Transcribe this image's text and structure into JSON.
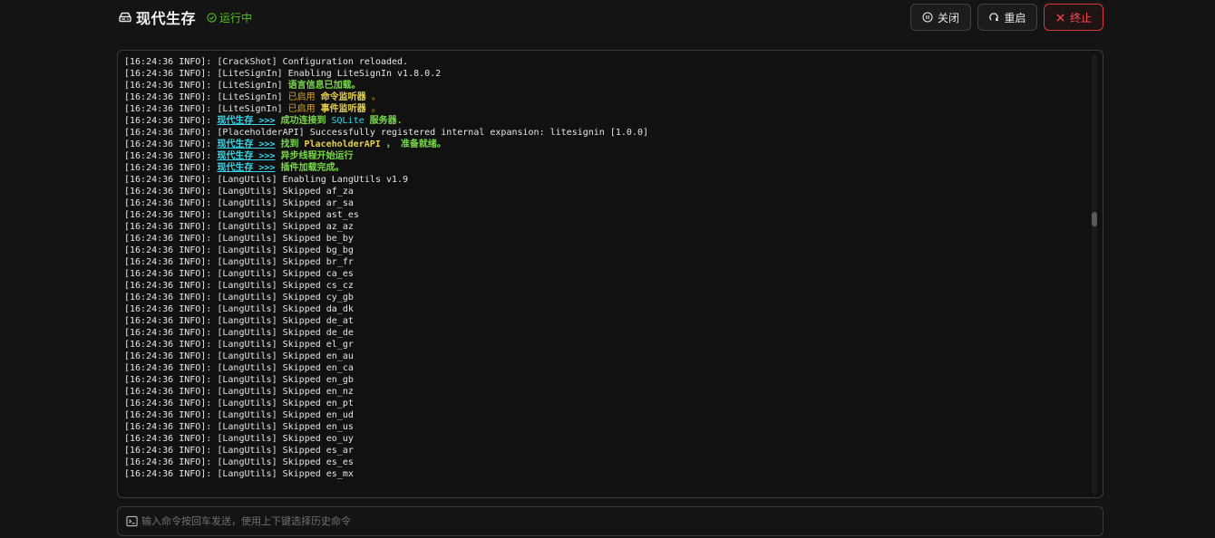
{
  "header": {
    "title": "现代生存",
    "status": "运行中",
    "buttons": {
      "close": "关闭",
      "restart": "重启",
      "stop": "终止"
    }
  },
  "icons": {
    "title": "server-icon",
    "status": "check-circle-icon",
    "close": "pause-circle-icon",
    "restart": "reload-icon",
    "stop": "close-x-icon",
    "command": "terminal-icon"
  },
  "colors": {
    "status": "#52c41a",
    "danger": "#ff4d4f",
    "highlight_cyan": "#38d6e8",
    "highlight_green": "#78d84a",
    "highlight_yellow": "#e7d04a"
  },
  "console": {
    "prefix": "[16:24:36 INFO]: ",
    "lines": [
      [
        {
          "t": "[CrackShot] Configuration reloaded."
        }
      ],
      [
        {
          "t": "[LiteSignIn] Enabling LiteSignIn v1.8.0.2"
        }
      ],
      [
        {
          "t": "[LiteSignIn] "
        },
        {
          "t": "语言信息已加载。",
          "c": "green"
        }
      ],
      [
        {
          "t": "[LiteSignIn] "
        },
        {
          "t": "已启用 ",
          "c": "gold"
        },
        {
          "t": "命令监听器",
          "c": "yellow"
        },
        {
          "t": " 。",
          "c": "gold"
        }
      ],
      [
        {
          "t": "[LiteSignIn] "
        },
        {
          "t": "已启用 ",
          "c": "gold"
        },
        {
          "t": "事件监听器",
          "c": "yellow"
        },
        {
          "t": " 。",
          "c": "gold"
        }
      ],
      [
        {
          "t": "现代生存 >>>",
          "c": "cyan"
        },
        {
          "t": " 成功连接到 ",
          "c": "green"
        },
        {
          "t": "SQLite",
          "c": "cyanp"
        },
        {
          "t": " 服务器.",
          "c": "green"
        }
      ],
      [
        {
          "t": "[PlaceholderAPI] Successfully registered internal expansion: litesignin [1.0.0]"
        }
      ],
      [
        {
          "t": "现代生存 >>>",
          "c": "cyan"
        },
        {
          "t": " 找到 ",
          "c": "green"
        },
        {
          "t": "PlaceholderAPI",
          "c": "yellow"
        },
        {
          "t": " ， 准备就绪。",
          "c": "green"
        }
      ],
      [
        {
          "t": "现代生存 >>>",
          "c": "cyan"
        },
        {
          "t": " 异步线程开始运行",
          "c": "green"
        }
      ],
      [
        {
          "t": "现代生存 >>>",
          "c": "cyan"
        },
        {
          "t": " 插件加载完成。",
          "c": "green"
        }
      ],
      [
        {
          "t": "[LangUtils] Enabling LangUtils v1.9"
        }
      ],
      [
        {
          "t": "[LangUtils] Skipped af_za"
        }
      ],
      [
        {
          "t": "[LangUtils] Skipped ar_sa"
        }
      ],
      [
        {
          "t": "[LangUtils] Skipped ast_es"
        }
      ],
      [
        {
          "t": "[LangUtils] Skipped az_az"
        }
      ],
      [
        {
          "t": "[LangUtils] Skipped be_by"
        }
      ],
      [
        {
          "t": "[LangUtils] Skipped bg_bg"
        }
      ],
      [
        {
          "t": "[LangUtils] Skipped br_fr"
        }
      ],
      [
        {
          "t": "[LangUtils] Skipped ca_es"
        }
      ],
      [
        {
          "t": "[LangUtils] Skipped cs_cz"
        }
      ],
      [
        {
          "t": "[LangUtils] Skipped cy_gb"
        }
      ],
      [
        {
          "t": "[LangUtils] Skipped da_dk"
        }
      ],
      [
        {
          "t": "[LangUtils] Skipped de_at"
        }
      ],
      [
        {
          "t": "[LangUtils] Skipped de_de"
        }
      ],
      [
        {
          "t": "[LangUtils] Skipped el_gr"
        }
      ],
      [
        {
          "t": "[LangUtils] Skipped en_au"
        }
      ],
      [
        {
          "t": "[LangUtils] Skipped en_ca"
        }
      ],
      [
        {
          "t": "[LangUtils] Skipped en_gb"
        }
      ],
      [
        {
          "t": "[LangUtils] Skipped en_nz"
        }
      ],
      [
        {
          "t": "[LangUtils] Skipped en_pt"
        }
      ],
      [
        {
          "t": "[LangUtils] Skipped en_ud"
        }
      ],
      [
        {
          "t": "[LangUtils] Skipped en_us"
        }
      ],
      [
        {
          "t": "[LangUtils] Skipped eo_uy"
        }
      ],
      [
        {
          "t": "[LangUtils] Skipped es_ar"
        }
      ],
      [
        {
          "t": "[LangUtils] Skipped es_es"
        }
      ],
      [
        {
          "t": "[LangUtils] Skipped es_mx"
        }
      ]
    ]
  },
  "command": {
    "placeholder": "输入命令按回车发送，使用上下键选择历史命令",
    "value": ""
  }
}
